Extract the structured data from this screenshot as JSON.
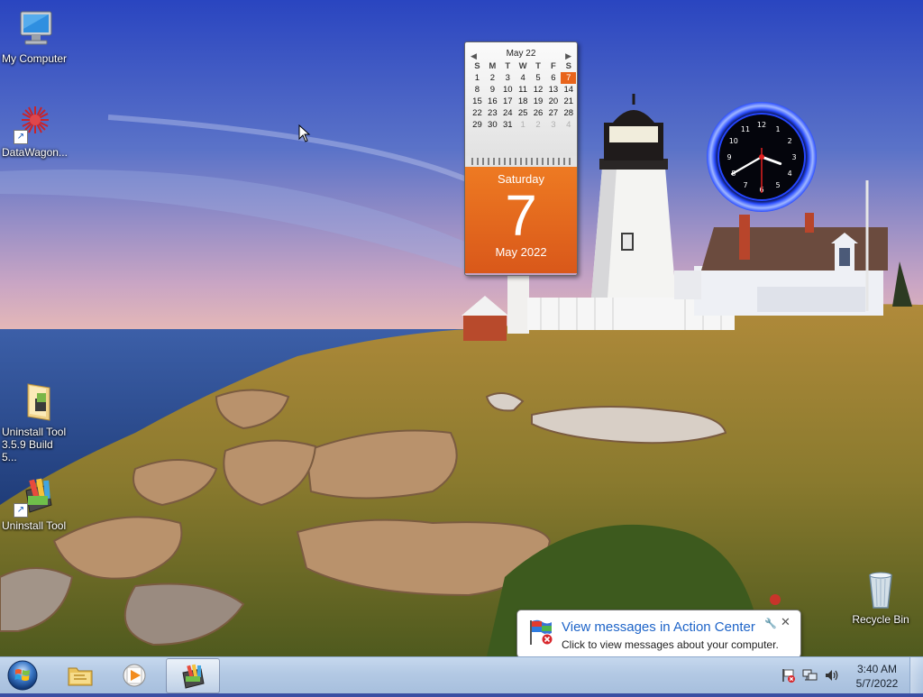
{
  "desktop": {
    "icons": [
      {
        "label": "My Computer",
        "icon": "computer-icon"
      },
      {
        "label": "DataWagon...",
        "icon": "datawagon-icon"
      },
      {
        "label": "Uninstall Tool\n3.5.9 Build 5...",
        "icon": "folder-icon"
      },
      {
        "label": "Uninstall Tool",
        "icon": "uninstall-tool-icon"
      },
      {
        "label": "Recycle Bin",
        "icon": "recycle-bin-icon"
      }
    ]
  },
  "calendar": {
    "month_label": "May 22",
    "weekdays": [
      "S",
      "M",
      "T",
      "W",
      "T",
      "F",
      "S"
    ],
    "weeks": [
      [
        "1",
        "2",
        "3",
        "4",
        "5",
        "6",
        "7"
      ],
      [
        "8",
        "9",
        "10",
        "11",
        "12",
        "13",
        "14"
      ],
      [
        "15",
        "16",
        "17",
        "18",
        "19",
        "20",
        "21"
      ],
      [
        "22",
        "23",
        "24",
        "25",
        "26",
        "27",
        "28"
      ],
      [
        "29",
        "30",
        "31",
        "1",
        "2",
        "3",
        "4"
      ]
    ],
    "today": "7",
    "weekday_name": "Saturday",
    "day_number": "7",
    "month_year": "May 2022",
    "accent": "#e8641b"
  },
  "clock": {
    "numerals": [
      "12",
      "1",
      "2",
      "3",
      "4",
      "5",
      "6",
      "7",
      "8",
      "9",
      "10",
      "11"
    ],
    "hour": 3,
    "minute": 40,
    "accent": "#1a3cff"
  },
  "notification": {
    "title": "View messages in Action Center",
    "text": "Click to view messages about your computer.",
    "icon": "action-center-flag-icon"
  },
  "taskbar": {
    "items": [
      {
        "name": "windows-explorer",
        "icon": "folder-icon",
        "active": false
      },
      {
        "name": "media-player",
        "icon": "media-player-icon",
        "active": false
      },
      {
        "name": "uninstall-tool",
        "icon": "uninstall-tool-icon",
        "active": true
      }
    ],
    "tray": {
      "time": "3:40 AM",
      "date": "5/7/2022",
      "icons": [
        "action-center-icon",
        "network-icon",
        "volume-icon"
      ]
    }
  }
}
